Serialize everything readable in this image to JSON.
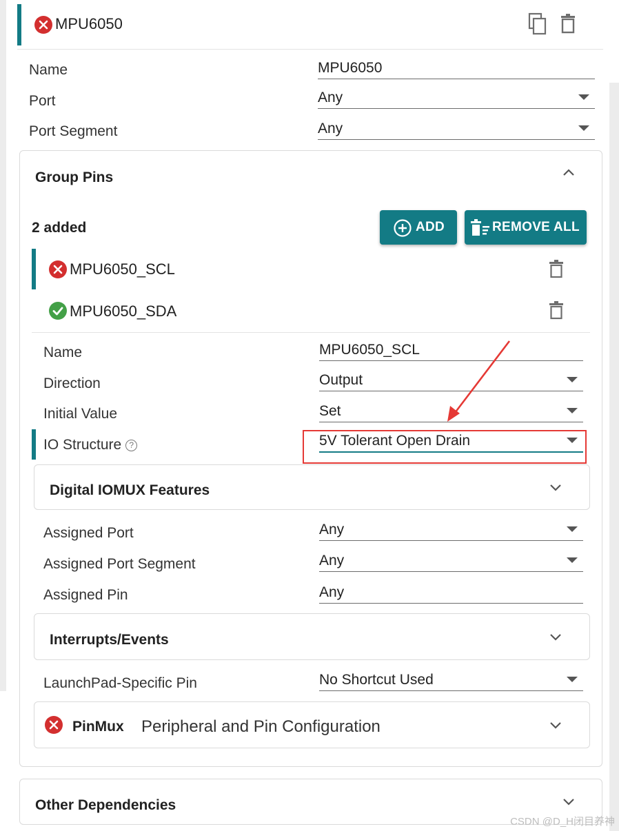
{
  "header": {
    "title": "MPU6050",
    "copy_icon": "copy-icon",
    "delete_icon": "trash-icon"
  },
  "form": {
    "name_label": "Name",
    "name_value": "MPU6050",
    "port_label": "Port",
    "port_value": "Any",
    "segment_label": "Port Segment",
    "segment_value": "Any"
  },
  "group_pins": {
    "title": "Group Pins",
    "count_label": "2 added",
    "add_label": "ADD",
    "remove_all_label": "REMOVE ALL",
    "pins": [
      {
        "name": "MPU6050_SCL",
        "status": "error"
      },
      {
        "name": "MPU6050_SDA",
        "status": "ok"
      }
    ]
  },
  "pin_config": {
    "name_label": "Name",
    "name_value": "MPU6050_SCL",
    "direction_label": "Direction",
    "direction_value": "Output",
    "initial_label": "Initial Value",
    "initial_value": "Set",
    "io_label": "IO Structure",
    "io_value": "5V Tolerant Open Drain",
    "help_glyph": "?",
    "iomux_title": "Digital IOMUX Features",
    "assigned_port_label": "Assigned Port",
    "assigned_port_value": "Any",
    "assigned_segment_label": "Assigned Port Segment",
    "assigned_segment_value": "Any",
    "assigned_pin_label": "Assigned Pin",
    "assigned_pin_value": "Any",
    "interrupts_title": "Interrupts/Events",
    "launchpad_label": "LaunchPad-Specific Pin",
    "launchpad_value": "No Shortcut Used",
    "pinmux_title": "PinMux",
    "pinmux_subtitle": "Peripheral and Pin Configuration"
  },
  "other": {
    "title": "Other Dependencies"
  },
  "watermark": "CSDN @D_H闭目养神",
  "colors": {
    "accent": "#137b85",
    "error": "#d32f2f",
    "ok": "#43a047",
    "annotation": "#e53935"
  }
}
